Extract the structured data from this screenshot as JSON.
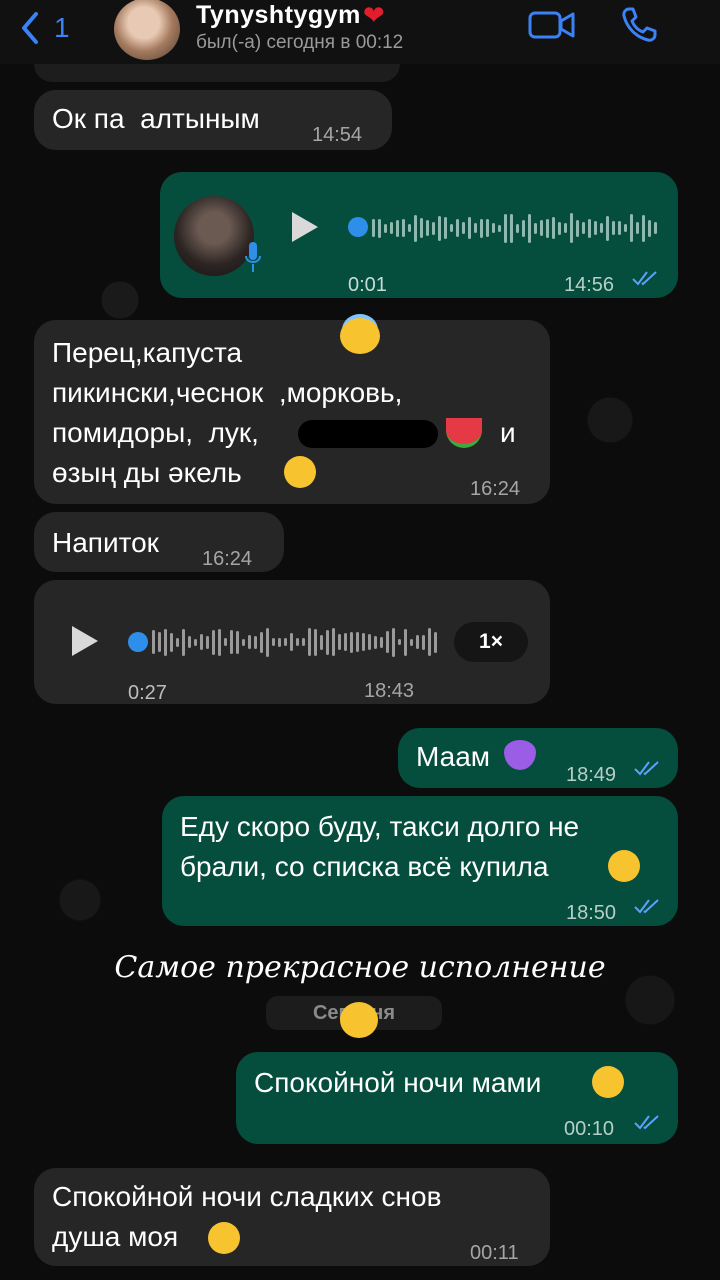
{
  "header": {
    "back_count": "1",
    "contact_name": "Tynyshtygym",
    "heart": "❤",
    "status": "был(-а) сегодня в 00:12"
  },
  "colors": {
    "accent": "#3b82f6",
    "incoming_bubble": "#262626",
    "outgoing_bubble": "#054d3c",
    "read_ticks": "#5aa2ff"
  },
  "messages": [
    {
      "text": "Ок па  алтыным",
      "time": "14:54"
    },
    {
      "voice_duration": "0:01",
      "time": "14:56"
    },
    {
      "line1": "Перец,капуста",
      "line2": "пикински,чеснок  ,морковь,",
      "line3a": "помидоры,  лук,",
      "line3b": "и",
      "line4": "өзың ды әкель",
      "time": "16:24"
    },
    {
      "text": "Напиток",
      "time": "16:24"
    },
    {
      "voice_duration": "0:27",
      "time": "18:43",
      "speed": "1×"
    },
    {
      "text": "Маам",
      "time": "18:49"
    },
    {
      "line1": "Еду скоро буду, такси долго не",
      "line2": "брали, со списка всё купила",
      "time": "18:50"
    },
    {
      "text": "Спокойной ночи мами",
      "time": "00:10"
    },
    {
      "line1": "Спокойной ночи сладких снов",
      "line2": "душа моя",
      "time": "00:11"
    }
  ],
  "overlay_caption": "Самое прекрасное исполнение",
  "date_separator": "Сегодня",
  "icons": [
    "chevron-left-icon",
    "video-icon",
    "phone-icon",
    "play-icon",
    "microphone-icon",
    "double-check-icon"
  ]
}
